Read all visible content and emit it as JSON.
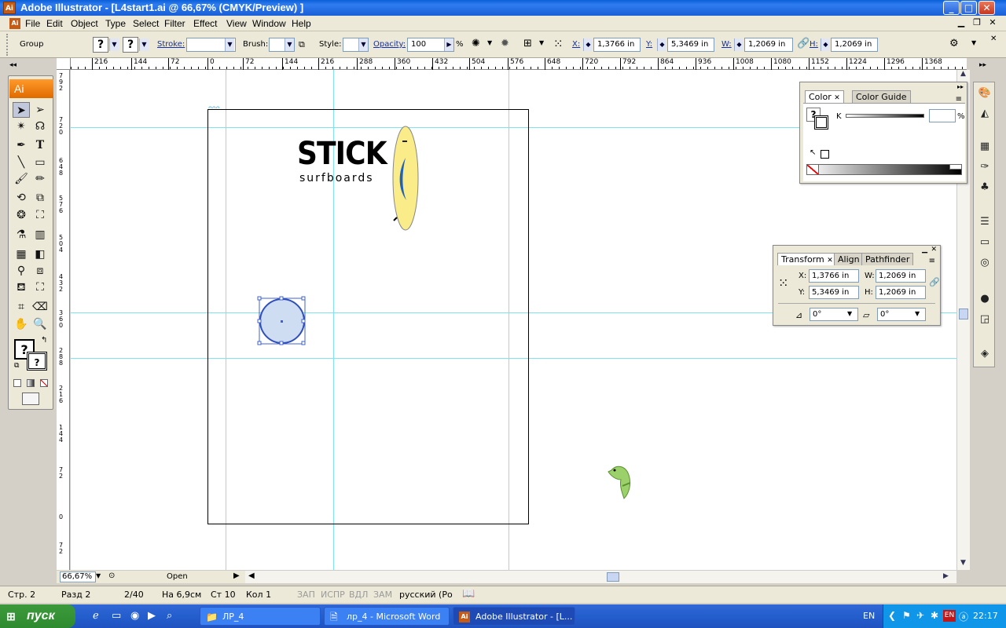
{
  "window": {
    "title": "Adobe Illustrator - [L4start1.ai @ 66,67% (CMYK/Preview) ]",
    "app_icon": "Ai",
    "minimize": "_",
    "maximize": "□",
    "close": "✕"
  },
  "menu": [
    "File",
    "Edit",
    "Object",
    "Type",
    "Select",
    "Filter",
    "Effect",
    "View",
    "Window",
    "Help"
  ],
  "control": {
    "selection_type": "Group",
    "stroke_label": "Stroke:",
    "brush_label": "Brush:",
    "style_label": "Style:",
    "opacity_label": "Opacity:",
    "opacity_value": "100",
    "percent": "%",
    "x_label": "X:",
    "x_value": "1,3766 in",
    "y_label": "Y:",
    "y_value": "5,3469 in",
    "w_label": "W:",
    "w_value": "1,2069 in",
    "h_label": "H:",
    "h_value": "1,2069 in",
    "q": "?"
  },
  "ruler_h": [
    "216",
    "144",
    "72",
    "0",
    "72",
    "144",
    "216",
    "288",
    "360",
    "432",
    "504",
    "576",
    "648",
    "720",
    "792",
    "864",
    "936",
    "1008",
    "1080",
    "1152",
    "1224",
    "1296",
    "1368"
  ],
  "ruler_v": [
    "7",
    "9",
    "2",
    "7",
    "2",
    "0",
    "6",
    "4",
    "8",
    "5",
    "7",
    "6",
    "5",
    "0",
    "4",
    "4",
    "3",
    "2",
    "3",
    "6",
    "0",
    "2",
    "8",
    "8",
    "2",
    "1",
    "6",
    "1",
    "4",
    "4",
    "7",
    "2",
    "0",
    "7",
    "2"
  ],
  "artwork": {
    "logo_main": "STICK",
    "logo_sub": "surfboards"
  },
  "color_panel": {
    "tab_color": "Color",
    "tab_guide": "Color Guide",
    "k_label": "K",
    "percent": "%"
  },
  "transform_panel": {
    "tab_transform": "Transform",
    "tab_align": "Align",
    "tab_pathfinder": "Pathfinder",
    "x_label": "X:",
    "x_value": "1,3766 in",
    "y_label": "Y:",
    "y_value": "5,3469 in",
    "w_label": "W:",
    "w_value": "1,2069 in",
    "h_label": "H:",
    "h_value": "1,2069 in",
    "rotate_value": "0°",
    "shear_value": "0°"
  },
  "zoom": {
    "value": "66,67%",
    "status": "Open"
  },
  "word_status": {
    "page": "Стр. 2",
    "section": "Разд 2",
    "pages": "2/40",
    "at": "На 6,9см",
    "line": "Ст 10",
    "col": "Кол 1",
    "rec": "ЗАП",
    "trk": "ИСПР",
    "ext": "ВДЛ",
    "ovr": "ЗАМ",
    "lang": "русский (Ро"
  },
  "taskbar": {
    "start": "пуск",
    "tasks": [
      "ЛР_4",
      "лр_4 - Microsoft Word",
      "Adobe Illustrator - [L..."
    ],
    "lang": "EN",
    "clock": "22:17"
  },
  "colors": {
    "guide": "#7fe4ee",
    "xp_blue": "#245ecd",
    "selection": "#4060d0"
  }
}
